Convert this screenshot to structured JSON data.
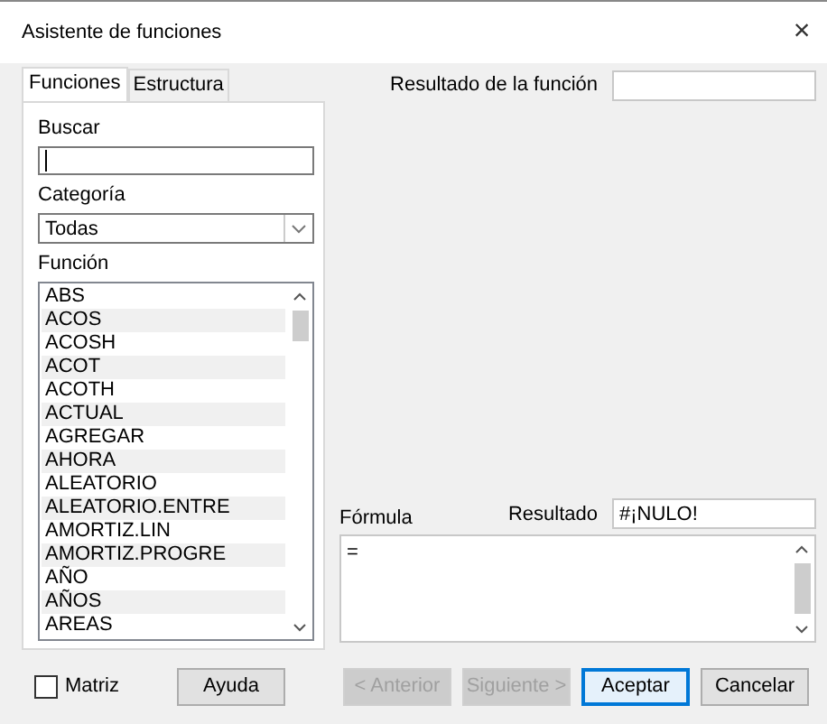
{
  "window": {
    "title": "Asistente de funciones",
    "close": "×"
  },
  "tabs": [
    {
      "label": "Funciones",
      "selected": true
    },
    {
      "label": "Estructura",
      "selected": false
    }
  ],
  "search": {
    "label": "Buscar"
  },
  "category": {
    "label": "Categoría",
    "value": "Todas"
  },
  "functions": {
    "label": "Función",
    "items": [
      "ABS",
      "ACOS",
      "ACOSH",
      "ACOT",
      "ACOTH",
      "ACTUAL",
      "AGREGAR",
      "AHORA",
      "ALEATORIO",
      "ALEATORIO.ENTRE",
      "AMORTIZ.LIN",
      "AMORTIZ.PROGRE",
      "AÑO",
      "AÑOS",
      "AREAS"
    ]
  },
  "function_result": {
    "label": "Resultado de la función"
  },
  "formula": {
    "label": "Fórmula",
    "value": "="
  },
  "result": {
    "label": "Resultado",
    "value": "#¡NULO!"
  },
  "matrix": {
    "label": "Matriz",
    "checked": false
  },
  "help_button": {
    "label": "Ayuda"
  },
  "buttons": [
    {
      "label": "< Anterior",
      "disabled": true,
      "default": false
    },
    {
      "label": "Siguiente >",
      "disabled": true,
      "default": false
    },
    {
      "label": "Aceptar",
      "disabled": false,
      "default": true
    },
    {
      "label": "Cancelar",
      "disabled": false,
      "default": false
    }
  ]
}
